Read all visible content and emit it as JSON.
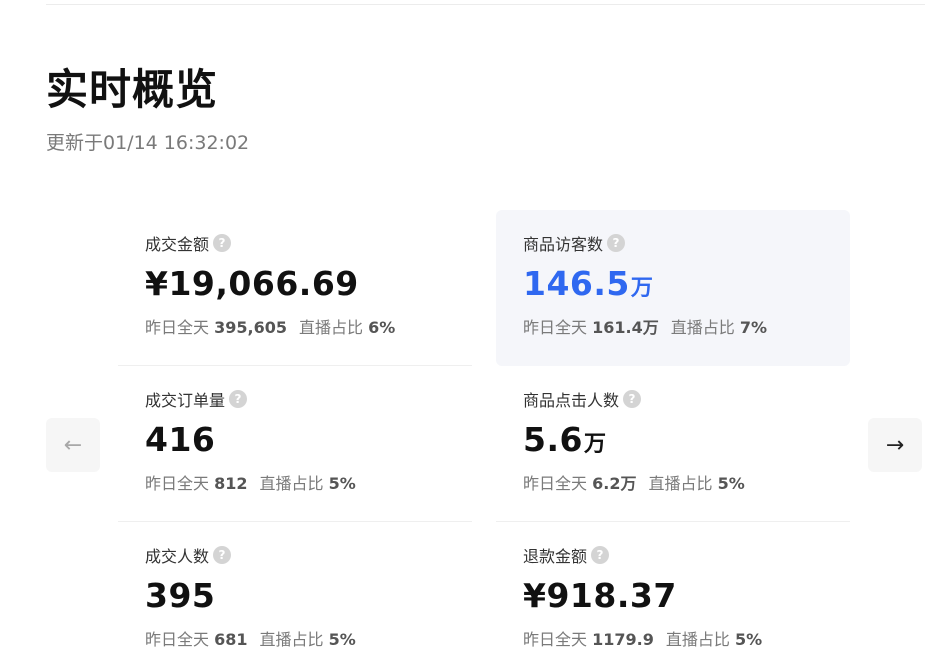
{
  "header": {
    "title": "实时概览",
    "updated": "更新于01/14 16:32:02"
  },
  "nav": {
    "prev_icon": "arrow-left-icon",
    "next_icon": "arrow-right-icon"
  },
  "metrics": [
    {
      "label": "成交金额",
      "value": "¥19,066.69",
      "unit": "",
      "yesterday_label": "昨日全天",
      "yesterday_value": "395,605",
      "live_label": "直播占比",
      "live_value": "6%"
    },
    {
      "label": "商品访客数",
      "value": "146.5",
      "unit": "万",
      "yesterday_label": "昨日全天",
      "yesterday_value": "161.4万",
      "live_label": "直播占比",
      "live_value": "7%",
      "selected": true
    },
    {
      "label": "成交订单量",
      "value": "416",
      "unit": "",
      "yesterday_label": "昨日全天",
      "yesterday_value": "812",
      "live_label": "直播占比",
      "live_value": "5%"
    },
    {
      "label": "商品点击人数",
      "value": "5.6",
      "unit": "万",
      "yesterday_label": "昨日全天",
      "yesterday_value": "6.2万",
      "live_label": "直播占比",
      "live_value": "5%"
    },
    {
      "label": "成交人数",
      "value": "395",
      "unit": "",
      "yesterday_label": "昨日全天",
      "yesterday_value": "681",
      "live_label": "直播占比",
      "live_value": "5%"
    },
    {
      "label": "退款金额",
      "value": "¥918.37",
      "unit": "",
      "yesterday_label": "昨日全天",
      "yesterday_value": "1179.9",
      "live_label": "直播占比",
      "live_value": "5%"
    }
  ],
  "colors": {
    "accent": "#2f68f0",
    "selected_bg": "#f5f6fa",
    "muted_text": "#7a7a7a"
  }
}
